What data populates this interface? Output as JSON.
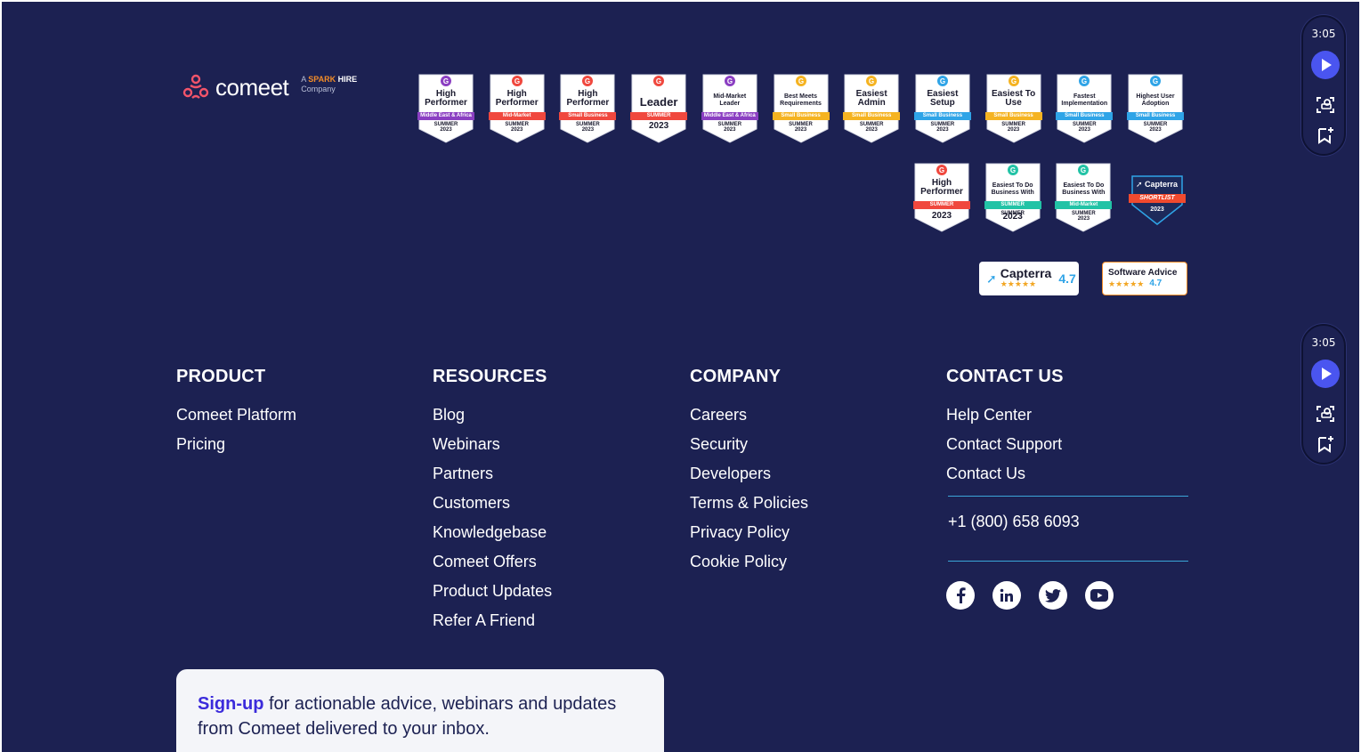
{
  "logo": {
    "name": "comeet",
    "sub_prefix": "A",
    "sub_brand_1": "SPARK",
    "sub_brand_2": "HIRE",
    "sub_suffix": "Company"
  },
  "badges_row1": [
    {
      "title": "High Performer",
      "ribbon": "Middle East & Africa",
      "season": "SUMMER",
      "year": "2023",
      "color": "#8b3fc2"
    },
    {
      "title": "High Performer",
      "ribbon": "Mid-Market",
      "season": "SUMMER",
      "year": "2023",
      "color": "#f0483e"
    },
    {
      "title": "High Performer",
      "ribbon": "Small Business",
      "season": "SUMMER",
      "year": "2023",
      "color": "#f0483e"
    },
    {
      "title": "Leader",
      "ribbon": "SUMMER",
      "season": "SUMMER",
      "year": "2023",
      "color": "#f0483e"
    },
    {
      "title": "Mid-Market Leader",
      "ribbon": "Middle East & Africa",
      "season": "SUMMER",
      "year": "2023",
      "color": "#8b3fc2"
    },
    {
      "title": "Best Meets Requirements",
      "ribbon": "Small Business",
      "season": "SUMMER",
      "year": "2023",
      "color": "#f5b321"
    },
    {
      "title": "Easiest Admin",
      "ribbon": "Small Business",
      "season": "SUMMER",
      "year": "2023",
      "color": "#f5b321"
    },
    {
      "title": "Easiest Setup",
      "ribbon": "Small Business",
      "season": "SUMMER",
      "year": "2023",
      "color": "#2fa4e7"
    },
    {
      "title": "Easiest To Use",
      "ribbon": "Small Business",
      "season": "SUMMER",
      "year": "2023",
      "color": "#f5b321"
    },
    {
      "title": "Fastest Implementation",
      "ribbon": "Small Business",
      "season": "SUMMER",
      "year": "2023",
      "color": "#2fa4e7"
    },
    {
      "title": "Highest User Adoption",
      "ribbon": "Small Business",
      "season": "SUMMER",
      "year": "2023",
      "color": "#2fa4e7"
    }
  ],
  "badges_row2": [
    {
      "title": "High Performer",
      "ribbon": "SUMMER",
      "season": "SUMMER",
      "year": "2023",
      "color": "#f0483e"
    },
    {
      "title": "Easiest To Do Business With",
      "ribbon": "SUMMER",
      "season": "SUMMER",
      "year": "2023",
      "color": "#22c3a6"
    },
    {
      "title": "Easiest To Do Business With",
      "ribbon": "Mid-Market",
      "season": "SUMMER",
      "year": "2023",
      "color": "#22c3a6"
    }
  ],
  "capterra_shortlist": {
    "brand": "Capterra",
    "ribbon": "SHORTLIST",
    "year": "2023"
  },
  "ratings": {
    "capterra": {
      "name": "Capterra",
      "stars": "★★★★★",
      "score": "4.7"
    },
    "software_advice": {
      "name": "Software Advice",
      "stars": "★★★★★",
      "score": "4.7"
    }
  },
  "columns": {
    "product": {
      "heading": "PRODUCT",
      "links": [
        "Comeet Platform",
        "Pricing"
      ]
    },
    "resources": {
      "heading": "RESOURCES",
      "links": [
        "Blog",
        "Webinars",
        "Partners",
        "Customers",
        "Knowledgebase",
        "Comeet Offers",
        "Product Updates",
        "Refer A Friend"
      ]
    },
    "company": {
      "heading": "COMPANY",
      "links": [
        "Careers",
        "Security",
        "Developers",
        "Terms & Policies",
        "Privacy Policy",
        "Cookie Policy"
      ]
    },
    "contact": {
      "heading": "CONTACT US",
      "links": [
        "Help Center",
        "Contact Support",
        "Contact Us"
      ]
    }
  },
  "phone": "+1 (800) 658 6093",
  "social": [
    "facebook-icon",
    "linkedin-icon",
    "twitter-icon",
    "youtube-icon"
  ],
  "signup": {
    "strong": "Sign-up",
    "text": " for actionable advice, webinars and updates from Comeet delivered to your inbox."
  },
  "widgets": [
    {
      "time": "3:05"
    },
    {
      "time": "3:05"
    }
  ],
  "colors": {
    "background": "#1c2152",
    "accent": "#3b2bdb",
    "divider": "#3ba6d8",
    "play": "#4a55f0"
  }
}
